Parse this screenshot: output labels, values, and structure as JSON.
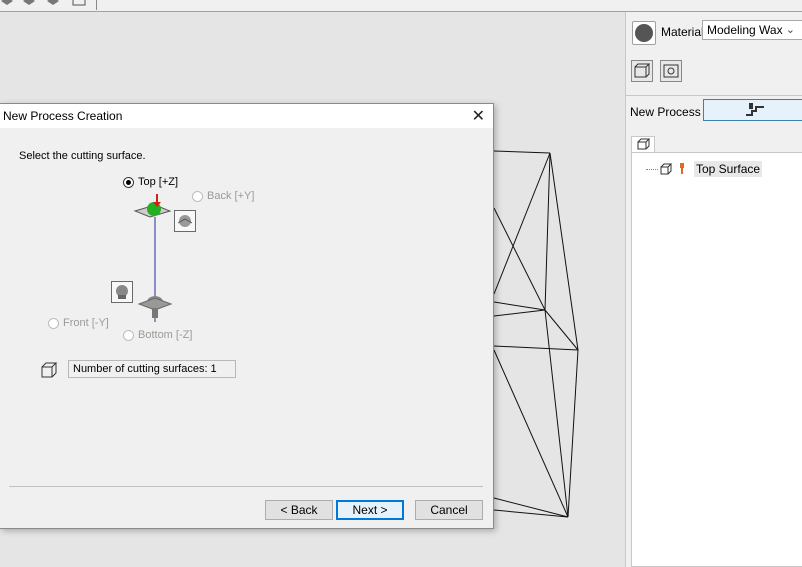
{
  "dialog": {
    "title": "New Process Creation",
    "close_glyph": "✕",
    "prompt": "Select the cutting surface.",
    "options": {
      "top": "Top [+Z]",
      "back": "Back [+Y]",
      "front": "Front [-Y]",
      "bottom": "Bottom [-Z]"
    },
    "selected_option": "top",
    "count_text": "Number of cutting surfaces: 1",
    "buttons": {
      "back": "< Back",
      "next": "Next >",
      "cancel": "Cancel"
    }
  },
  "right_panel": {
    "material_label": "Material",
    "material_value": "Modeling Wax",
    "new_process_label": "New Process",
    "tree": {
      "items": [
        {
          "label": "Top Surface"
        }
      ]
    }
  },
  "icons": {
    "material": "material-icon",
    "surface_colors": {
      "green": "#22b022",
      "red": "#d0201a",
      "axis": "#2a2aa0"
    }
  }
}
